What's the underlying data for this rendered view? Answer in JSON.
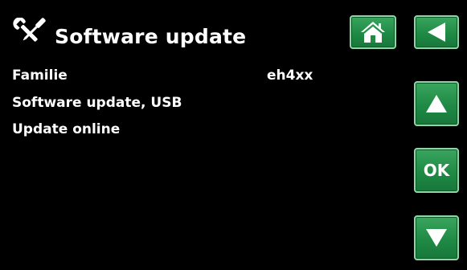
{
  "header": {
    "title": "Software update",
    "icon": "tools-icon"
  },
  "nav": {
    "home_icon": "home-icon",
    "back_icon": "back-arrow-icon",
    "up_icon": "up-arrow-icon",
    "ok_label": "OK",
    "down_icon": "down-arrow-icon"
  },
  "menu": {
    "items": [
      {
        "label": "Familie",
        "value": "eh4xx"
      },
      {
        "label": "Software update, USB"
      },
      {
        "label": "Update online"
      }
    ]
  },
  "colors": {
    "background": "#000000",
    "button_green": "#1f8a45",
    "button_border": "#8fd6a6",
    "text": "#ffffff"
  }
}
